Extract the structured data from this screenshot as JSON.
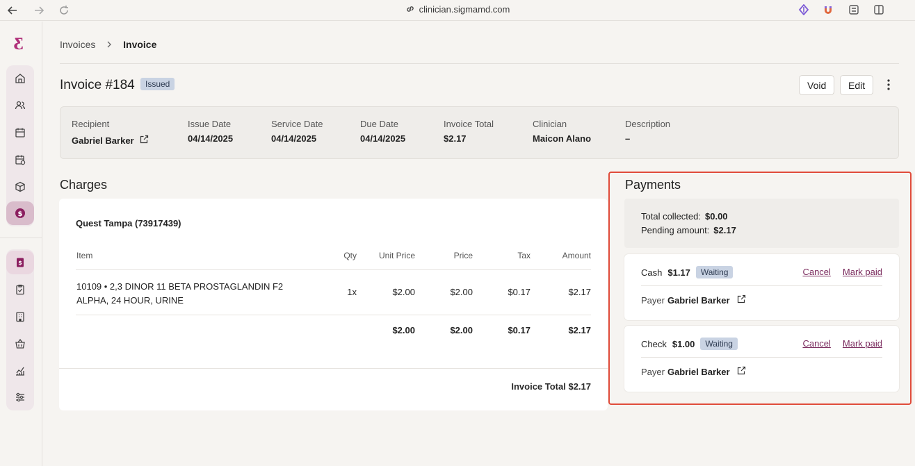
{
  "browser": {
    "url": "clinician.sigmamd.com"
  },
  "colors": {
    "accent": "#b0307a",
    "link": "#7a2a5d",
    "badge_bg": "#c9d3e3",
    "highlight": "#e04b3a"
  },
  "sidebar": {
    "logo": "Ƹ",
    "group1": [
      "home-icon",
      "users-icon",
      "calendar-icon",
      "calendar-check-icon",
      "box-icon",
      "dollar-icon"
    ],
    "group2": [
      "invoice-icon",
      "clipboard-icon",
      "building-icon",
      "basket-icon",
      "chart-icon",
      "sliders-icon"
    ]
  },
  "breadcrumb": {
    "parent": "Invoices",
    "current": "Invoice"
  },
  "header": {
    "title": "Invoice #184",
    "status": "Issued",
    "void_label": "Void",
    "edit_label": "Edit"
  },
  "info": {
    "recipient_label": "Recipient",
    "recipient": "Gabriel Barker",
    "issue_label": "Issue Date",
    "issue": "04/14/2025",
    "service_label": "Service Date",
    "service": "04/14/2025",
    "due_label": "Due Date",
    "due": "04/14/2025",
    "total_label": "Invoice Total",
    "total": "$2.17",
    "clinician_label": "Clinician",
    "clinician": "Maicon Alano",
    "description_label": "Description",
    "description": "–"
  },
  "charges": {
    "heading": "Charges",
    "lab": "Quest Tampa (73917439)",
    "columns": {
      "item": "Item",
      "qty": "Qty",
      "unit": "Unit Price",
      "price": "Price",
      "tax": "Tax",
      "amount": "Amount"
    },
    "row": {
      "item_line1": "10109 • 2,3 DINOR 11 BETA PROSTAGLANDIN F2",
      "item_line2": "ALPHA, 24 HOUR, URINE",
      "qty": "1x",
      "unit": "$2.00",
      "price": "$2.00",
      "tax": "$0.17",
      "amount": "$2.17"
    },
    "totals": {
      "unit": "$2.00",
      "price": "$2.00",
      "tax": "$0.17",
      "amount": "$2.17"
    },
    "invoice_total": "Invoice Total $2.17"
  },
  "payments": {
    "heading": "Payments",
    "collected_label": "Total collected:",
    "collected": "$0.00",
    "pending_label": "Pending amount:",
    "pending": "$2.17",
    "items": [
      {
        "method": "Cash",
        "amount": "$1.17",
        "status": "Waiting",
        "cancel": "Cancel",
        "mark_paid": "Mark paid",
        "payer_label": "Payer",
        "payer": "Gabriel Barker"
      },
      {
        "method": "Check",
        "amount": "$1.00",
        "status": "Waiting",
        "cancel": "Cancel",
        "mark_paid": "Mark paid",
        "payer_label": "Payer",
        "payer": "Gabriel Barker"
      }
    ]
  }
}
